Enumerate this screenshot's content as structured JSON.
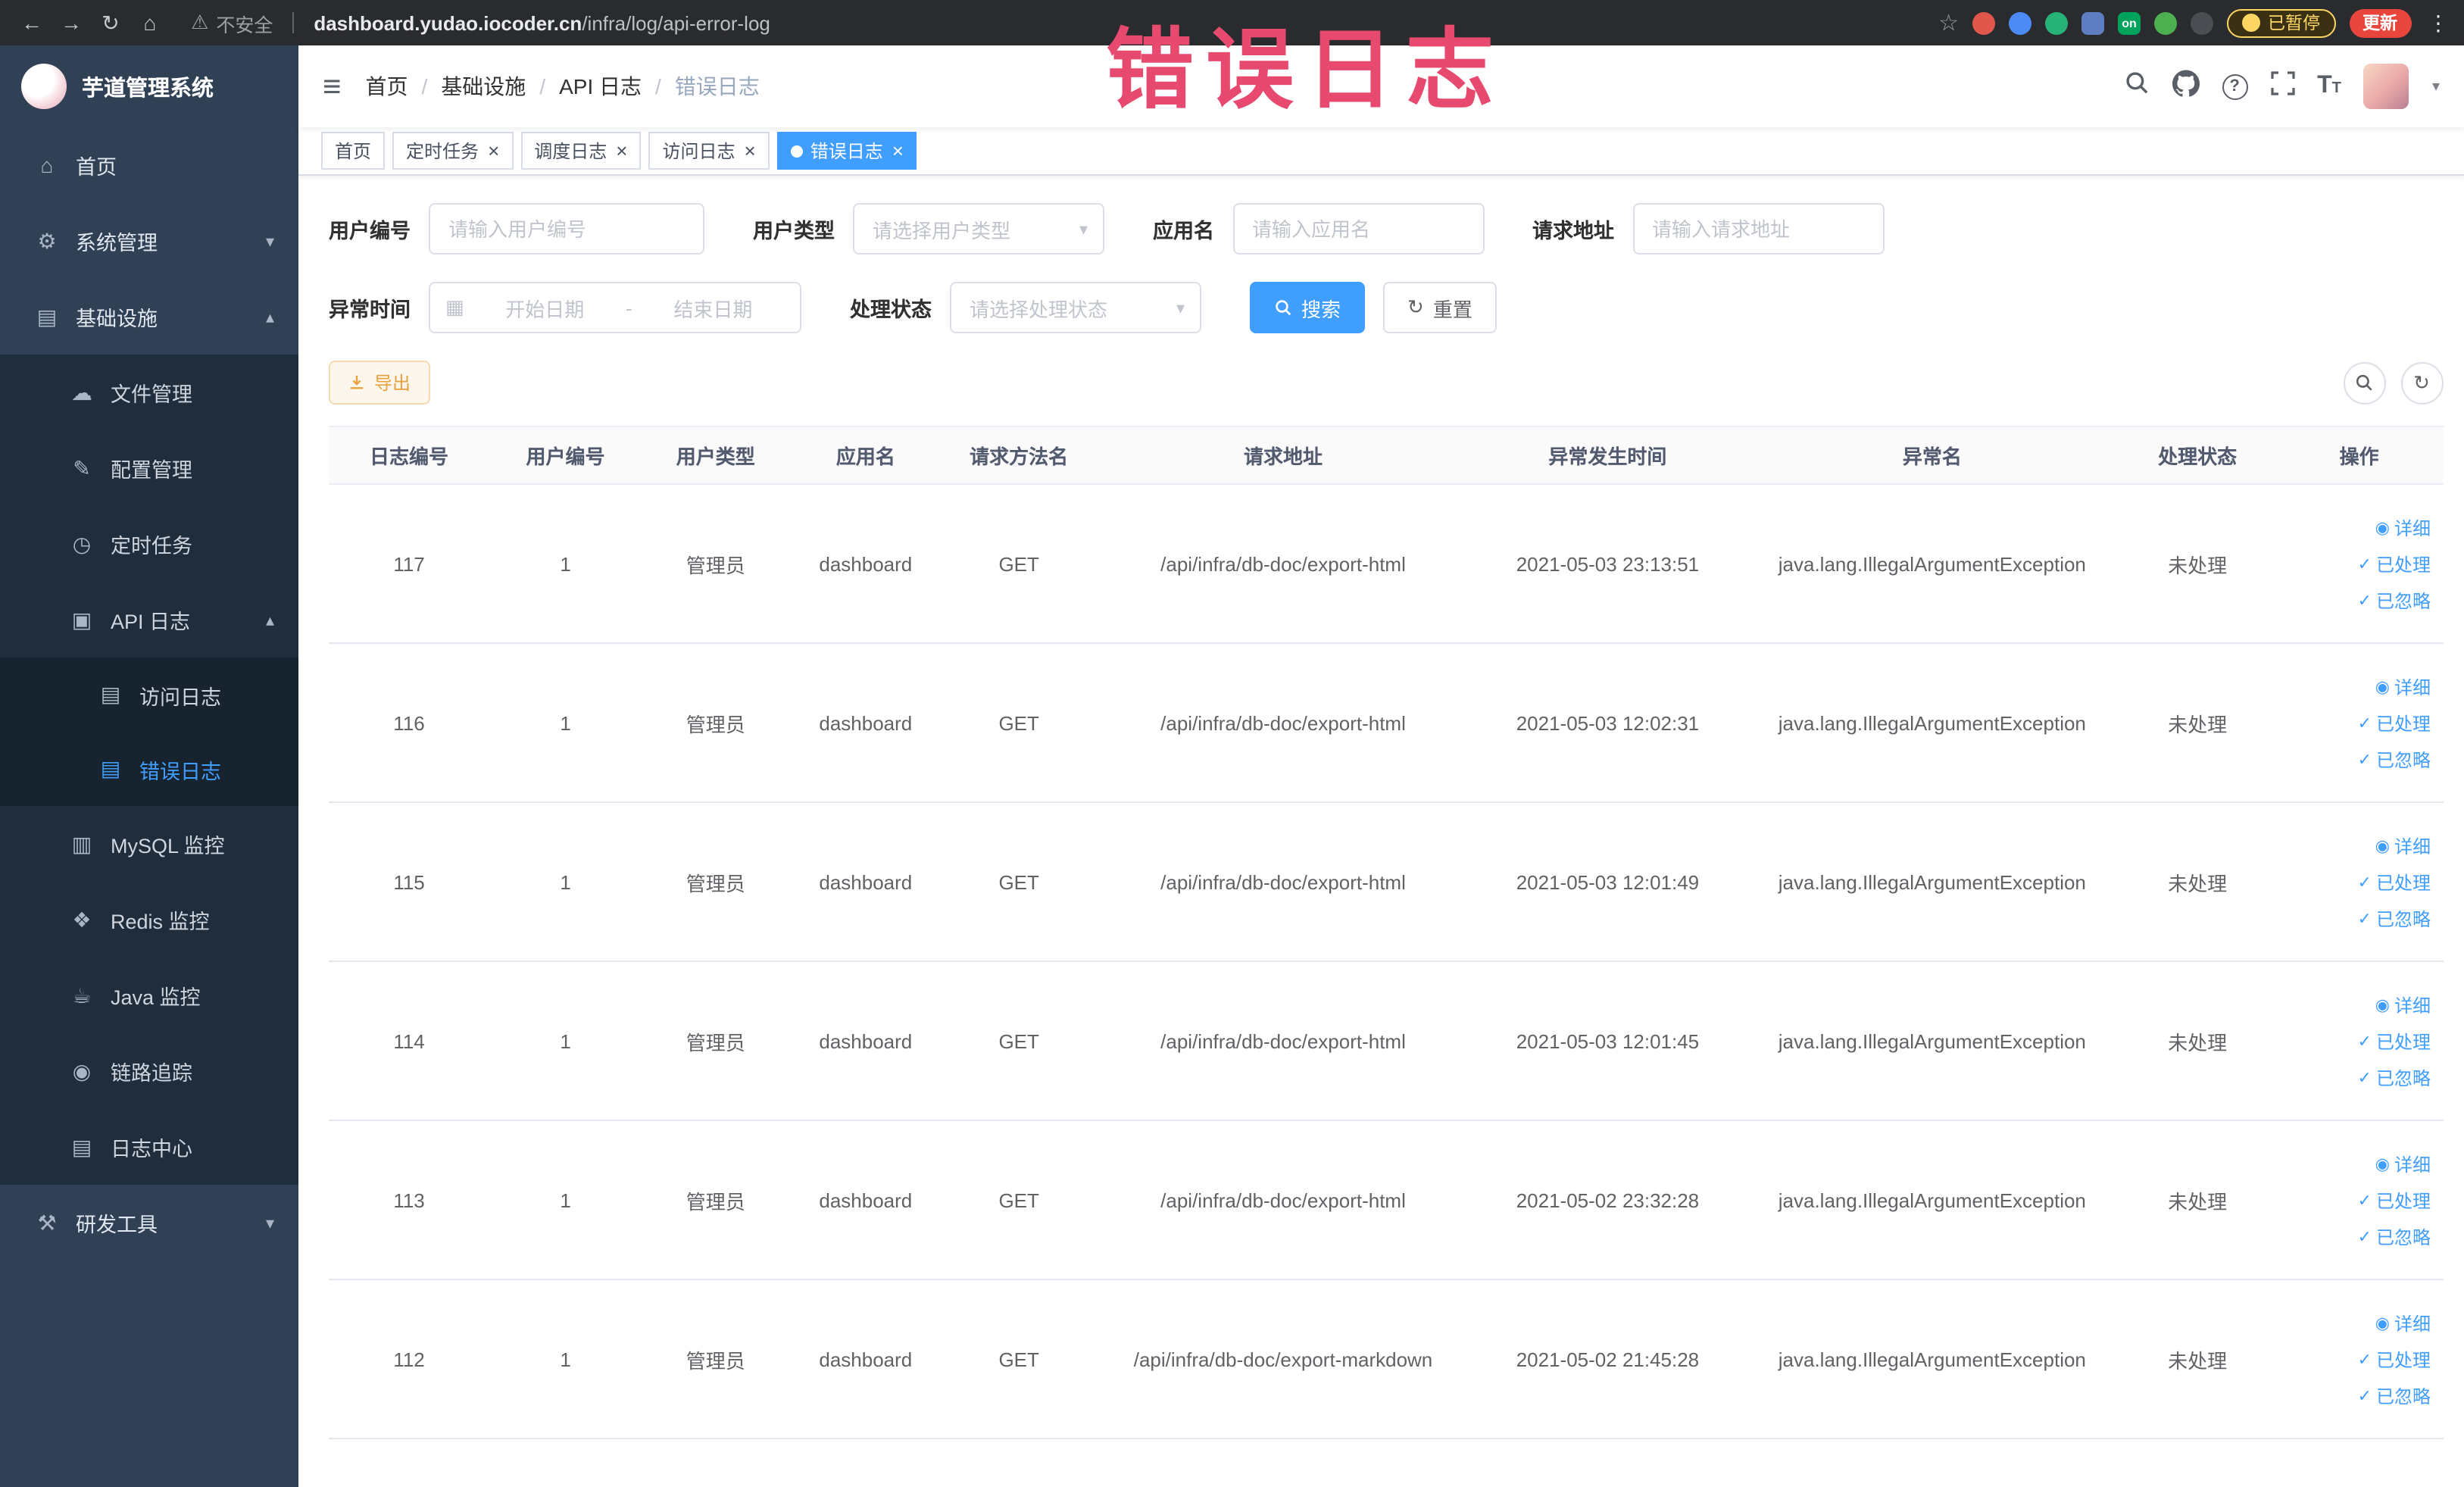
{
  "colors": {
    "primary": "#409eff",
    "sidebar_bg": "#304156",
    "submenu_bg": "#1f2d3d",
    "submenu2_bg": "#17232f",
    "watermark": "#e84a6f",
    "warning_btn": "#e6a23c"
  },
  "icons": {
    "back": "←",
    "forward": "→",
    "reload": "↻",
    "home_btn": "⌂",
    "warning": "⚠",
    "star": "☆",
    "more": "⋮",
    "hamburger": "≡",
    "caret_down": "▾",
    "chevron_down": "▾",
    "chevron_up": "▴",
    "home": "⌂",
    "system": "⚙",
    "infra": "▤",
    "file": "☁",
    "config": "✎",
    "timer": "◷",
    "apilog": "▣",
    "doc": "▤",
    "mysql": "▥",
    "redis": "❖",
    "java": "☕",
    "trace": "◉",
    "logcenter": "▤",
    "devtools": "⚒",
    "view": "◉",
    "check": "✓",
    "calendar": "▦",
    "refresh": "↻"
  },
  "browser": {
    "security_label": "不安全",
    "url_domain": "dashboard.yudao.iocoder.cn",
    "url_path": "/infra/log/api-error-log",
    "extension_badge": "on",
    "paused_badge": "已暂停",
    "update_badge": "更新"
  },
  "app": {
    "logo_title": "芋道管理系统"
  },
  "sidebar": {
    "menu": [
      {
        "label": "首页",
        "icon": "home"
      },
      {
        "label": "系统管理",
        "icon": "system",
        "children_collapsed": true
      },
      {
        "label": "基础设施",
        "icon": "infra",
        "expanded": true,
        "children": [
          {
            "label": "文件管理",
            "icon": "file"
          },
          {
            "label": "配置管理",
            "icon": "config"
          },
          {
            "label": "定时任务",
            "icon": "timer"
          },
          {
            "label": "API 日志",
            "icon": "apilog",
            "expanded": true,
            "children": [
              {
                "label": "访问日志",
                "icon": "doc"
              },
              {
                "label": "错误日志",
                "icon": "doc",
                "active": true
              }
            ]
          },
          {
            "label": "MySQL 监控",
            "icon": "mysql"
          },
          {
            "label": "Redis 监控",
            "icon": "redis"
          },
          {
            "label": "Java 监控",
            "icon": "java"
          },
          {
            "label": "链路追踪",
            "icon": "trace"
          },
          {
            "label": "日志中心",
            "icon": "logcenter"
          }
        ]
      },
      {
        "label": "研发工具",
        "icon": "devtools",
        "children_collapsed": true
      }
    ]
  },
  "header": {
    "breadcrumb": [
      "首页",
      "基础设施",
      "API 日志",
      "错误日志"
    ],
    "watermark": "错误日志"
  },
  "tabs": [
    {
      "label": "首页",
      "closable": false,
      "active": false
    },
    {
      "label": "定时任务",
      "closable": true,
      "active": false
    },
    {
      "label": "调度日志",
      "closable": true,
      "active": false
    },
    {
      "label": "访问日志",
      "closable": true,
      "active": false
    },
    {
      "label": "错误日志",
      "closable": true,
      "active": true
    }
  ],
  "filters": {
    "user_id_label": "用户编号",
    "user_id_placeholder": "请输入用户编号",
    "user_type_label": "用户类型",
    "user_type_placeholder": "请选择用户类型",
    "app_name_label": "应用名",
    "app_name_placeholder": "请输入应用名",
    "request_url_label": "请求地址",
    "request_url_placeholder": "请输入请求地址",
    "time_label": "异常时间",
    "time_start_placeholder": "开始日期",
    "time_separator": "-",
    "time_end_placeholder": "结束日期",
    "status_label": "处理状态",
    "status_placeholder": "请选择处理状态",
    "search_label": "搜索",
    "reset_label": "重置"
  },
  "toolbar": {
    "export_label": "导出"
  },
  "table": {
    "columns": [
      "日志编号",
      "用户编号",
      "用户类型",
      "应用名",
      "请求方法名",
      "请求地址",
      "异常发生时间",
      "异常名",
      "处理状态",
      "操作"
    ],
    "action_labels": [
      "详细",
      "已处理",
      "已忽略"
    ],
    "rows": [
      [
        "117",
        "1",
        "管理员",
        "dashboard",
        "GET",
        "/api/infra/db-doc/export-html",
        "2021-05-03 23:13:51",
        "java.lang.IllegalArgumentException",
        "未处理"
      ],
      [
        "116",
        "1",
        "管理员",
        "dashboard",
        "GET",
        "/api/infra/db-doc/export-html",
        "2021-05-03 12:02:31",
        "java.lang.IllegalArgumentException",
        "未处理"
      ],
      [
        "115",
        "1",
        "管理员",
        "dashboard",
        "GET",
        "/api/infra/db-doc/export-html",
        "2021-05-03 12:01:49",
        "java.lang.IllegalArgumentException",
        "未处理"
      ],
      [
        "114",
        "1",
        "管理员",
        "dashboard",
        "GET",
        "/api/infra/db-doc/export-html",
        "2021-05-03 12:01:45",
        "java.lang.IllegalArgumentException",
        "未处理"
      ],
      [
        "113",
        "1",
        "管理员",
        "dashboard",
        "GET",
        "/api/infra/db-doc/export-html",
        "2021-05-02 23:32:28",
        "java.lang.IllegalArgumentException",
        "未处理"
      ],
      [
        "112",
        "1",
        "管理员",
        "dashboard",
        "GET",
        "/api/infra/db-doc/export-markdown",
        "2021-05-02 21:45:28",
        "java.lang.IllegalArgumentException",
        "未处理"
      ]
    ]
  }
}
